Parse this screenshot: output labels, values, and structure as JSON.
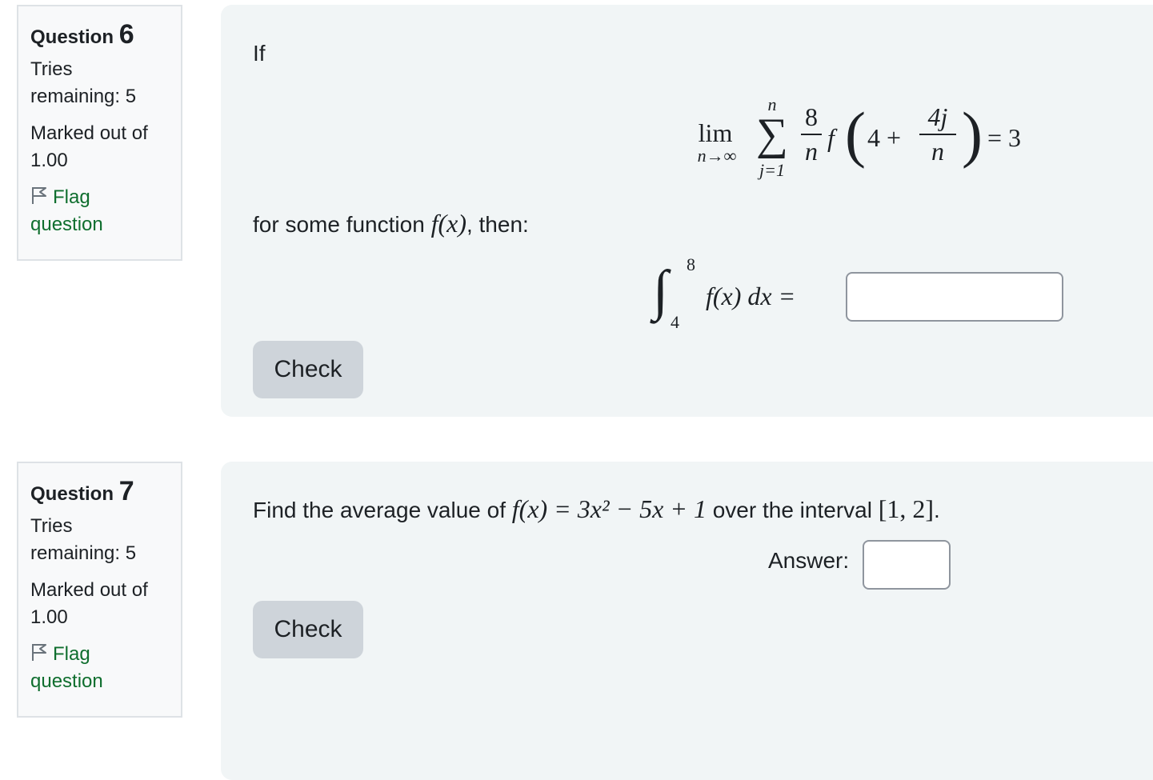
{
  "questions": [
    {
      "label": "Question",
      "number": "6",
      "tries_line1": "Tries",
      "tries_line2": "remaining: 5",
      "marked_line1": "Marked out of",
      "marked_line2": "1.00",
      "flag_line1": "Flag",
      "flag_line2": "question",
      "intro": "If",
      "limit_eq": {
        "lim": "lim",
        "lim_sub": "n→∞",
        "sum_top": "n",
        "sum_bottom": "j=1",
        "frac1_num": "8",
        "frac1_den": "n",
        "func": "f",
        "inner_left": "4 +",
        "frac2_num": "4j",
        "frac2_den": "n",
        "rhs": "= 3"
      },
      "mid_text_prefix": "for some function ",
      "mid_text_math": "f(x)",
      "mid_text_suffix": ", then:",
      "integral": {
        "upper": "8",
        "lower": "4",
        "integrand": "f(x) dx =",
        "answer_value": ""
      },
      "check_label": "Check"
    },
    {
      "label": "Question",
      "number": "7",
      "tries_line1": "Tries",
      "tries_line2": "remaining: 5",
      "marked_line1": "Marked out of",
      "marked_line2": "1.00",
      "flag_line1": "Flag",
      "flag_line2": "question",
      "prompt_prefix": "Find the average value of ",
      "prompt_math": "f(x) = 3x² − 5x + 1",
      "prompt_mid": " over the interval ",
      "prompt_interval": "[1, 2]",
      "prompt_suffix": ".",
      "answer_label": "Answer:",
      "answer_value": "",
      "check_label": "Check"
    }
  ],
  "colors": {
    "flag_link": "#0f6e2e",
    "content_bg": "#f1f5f6",
    "info_bg": "#f8f9fa",
    "button_bg": "#ced4da"
  },
  "icons": {
    "flag": "flag-outline-icon"
  }
}
